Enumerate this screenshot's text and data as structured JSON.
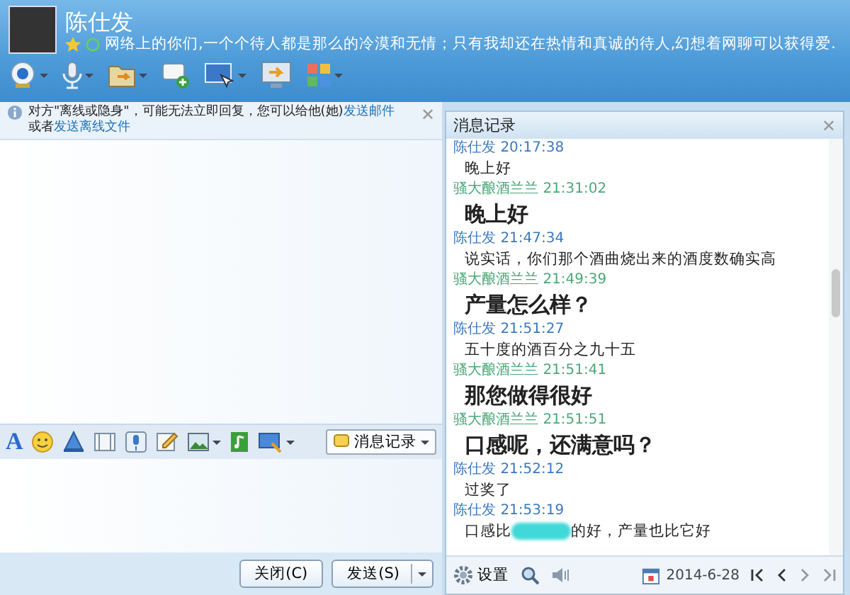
{
  "contact": {
    "name": "陈仕发",
    "signature": "网络上的你们,一个个待人都是那么的冷漠和无情；只有我却还在热情和真诚的待人,幻想着网聊可以获得爱."
  },
  "toolbar": [
    {
      "kind": "camera",
      "menu": true
    },
    {
      "kind": "mic",
      "menu": true
    },
    {
      "kind": "folder",
      "menu": true
    },
    {
      "kind": "chat-add",
      "menu": false
    },
    {
      "kind": "screen",
      "menu": true
    },
    {
      "kind": "monitor",
      "menu": false
    },
    {
      "kind": "apps",
      "menu": true
    }
  ],
  "notice": {
    "text": "对方\"离线或隐身\"，可能无法立即回复，您可以给他(她)",
    "link_mail": "发送邮件",
    "text2": "或者",
    "link_file": "发送离线文件"
  },
  "close_glyph": "✕",
  "format_toolbar": [
    {
      "kind": "font",
      "menu": false,
      "label": "A"
    },
    {
      "kind": "smiley",
      "menu": false
    },
    {
      "kind": "shake",
      "menu": false
    },
    {
      "kind": "frame",
      "menu": false
    },
    {
      "kind": "voice",
      "menu": false
    },
    {
      "kind": "note",
      "menu": false
    },
    {
      "kind": "image",
      "menu": true
    },
    {
      "kind": "music",
      "menu": false
    },
    {
      "kind": "screenshot",
      "menu": true
    }
  ],
  "history_button": "消息记录",
  "close_button": "关闭(C)",
  "send_button": "发送(S)",
  "history": {
    "title": "消息记录",
    "messages": [
      {
        "sender": "陈仕发",
        "time": "20:17:38",
        "color": "#3a78c0",
        "kind": "normal",
        "segments": [
          {
            "kind": "text",
            "text": "晚上好"
          }
        ]
      },
      {
        "sender": "骚大酿酒兰兰",
        "time": "21:31:02",
        "color": "#4aa878",
        "kind": "large",
        "segments": [
          {
            "kind": "text",
            "text": "晚上好"
          }
        ]
      },
      {
        "sender": "陈仕发",
        "time": "21:47:34",
        "color": "#3a78c0",
        "kind": "normal",
        "segments": [
          {
            "kind": "text",
            "text": "说实话，你们那个酒曲烧出来的酒度数确实高"
          }
        ]
      },
      {
        "sender": "骚大酿酒兰兰",
        "time": "21:49:39",
        "color": "#4aa878",
        "kind": "large",
        "segments": [
          {
            "kind": "text",
            "text": "产量怎么样？"
          }
        ]
      },
      {
        "sender": "陈仕发",
        "time": "21:51:27",
        "color": "#3a78c0",
        "kind": "normal",
        "segments": [
          {
            "kind": "text",
            "text": "五十度的酒百分之九十五"
          }
        ]
      },
      {
        "sender": "骚大酿酒兰兰",
        "time": "21:51:41",
        "color": "#4aa878",
        "kind": "large",
        "segments": [
          {
            "kind": "text",
            "text": "那您做得很好"
          }
        ]
      },
      {
        "sender": "骚大酿酒兰兰",
        "time": "21:51:51",
        "color": "#4aa878",
        "kind": "large",
        "segments": [
          {
            "kind": "text",
            "text": "口感呢，还满意吗？"
          }
        ]
      },
      {
        "sender": "陈仕发",
        "time": "21:52:12",
        "color": "#3a78c0",
        "kind": "normal",
        "segments": [
          {
            "kind": "text",
            "text": "过奖了"
          }
        ]
      },
      {
        "sender": "陈仕发",
        "time": "21:53:19",
        "color": "#3a78c0",
        "kind": "normal",
        "segments": [
          {
            "kind": "text",
            "text": "口感比"
          },
          {
            "kind": "blur"
          },
          {
            "kind": "text",
            "text": "的好，产量也比它好"
          }
        ]
      }
    ],
    "settings": "设置",
    "date": "2014-6-28"
  }
}
